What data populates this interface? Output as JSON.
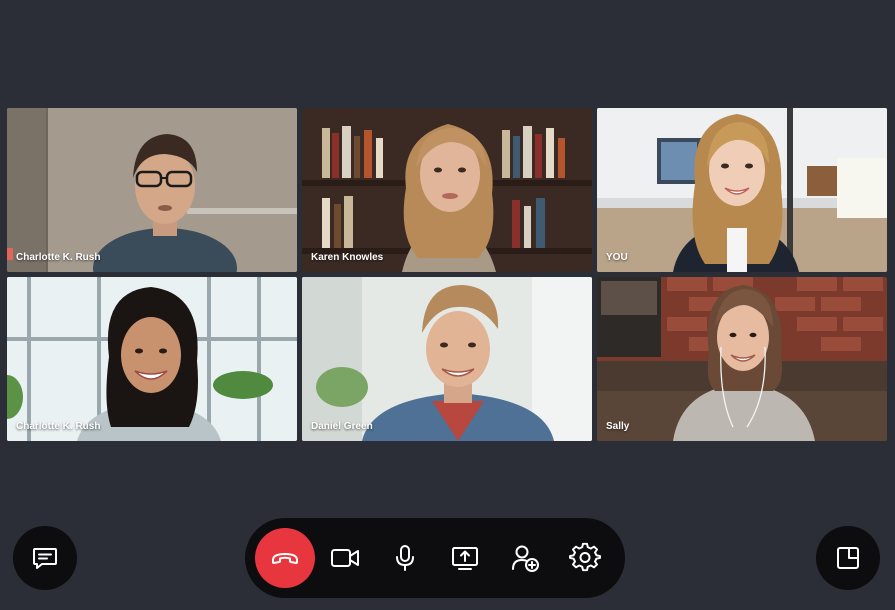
{
  "colors": {
    "background": "#2b2d37",
    "bar": "#0d0d10",
    "end_call": "#e8363f",
    "icon": "#ffffff"
  },
  "participants": [
    {
      "name": "Charlotte K. Rush"
    },
    {
      "name": "Karen Knowles"
    },
    {
      "name": "YOU"
    },
    {
      "name": "Charlotte K. Rush"
    },
    {
      "name": "Daniel Green"
    },
    {
      "name": "Sally"
    }
  ],
  "controls": [
    {
      "icon": "phone-hangup-icon",
      "action": "end-call"
    },
    {
      "icon": "video-camera-icon",
      "action": "camera"
    },
    {
      "icon": "microphone-icon",
      "action": "microphone"
    },
    {
      "icon": "share-screen-icon",
      "action": "share-screen"
    },
    {
      "icon": "add-person-icon",
      "action": "add-participant"
    },
    {
      "icon": "gear-icon",
      "action": "settings"
    }
  ],
  "side_buttons": [
    {
      "icon": "chat-icon",
      "action": "chat"
    },
    {
      "icon": "picture-in-picture-icon",
      "action": "picture-in-picture"
    }
  ]
}
